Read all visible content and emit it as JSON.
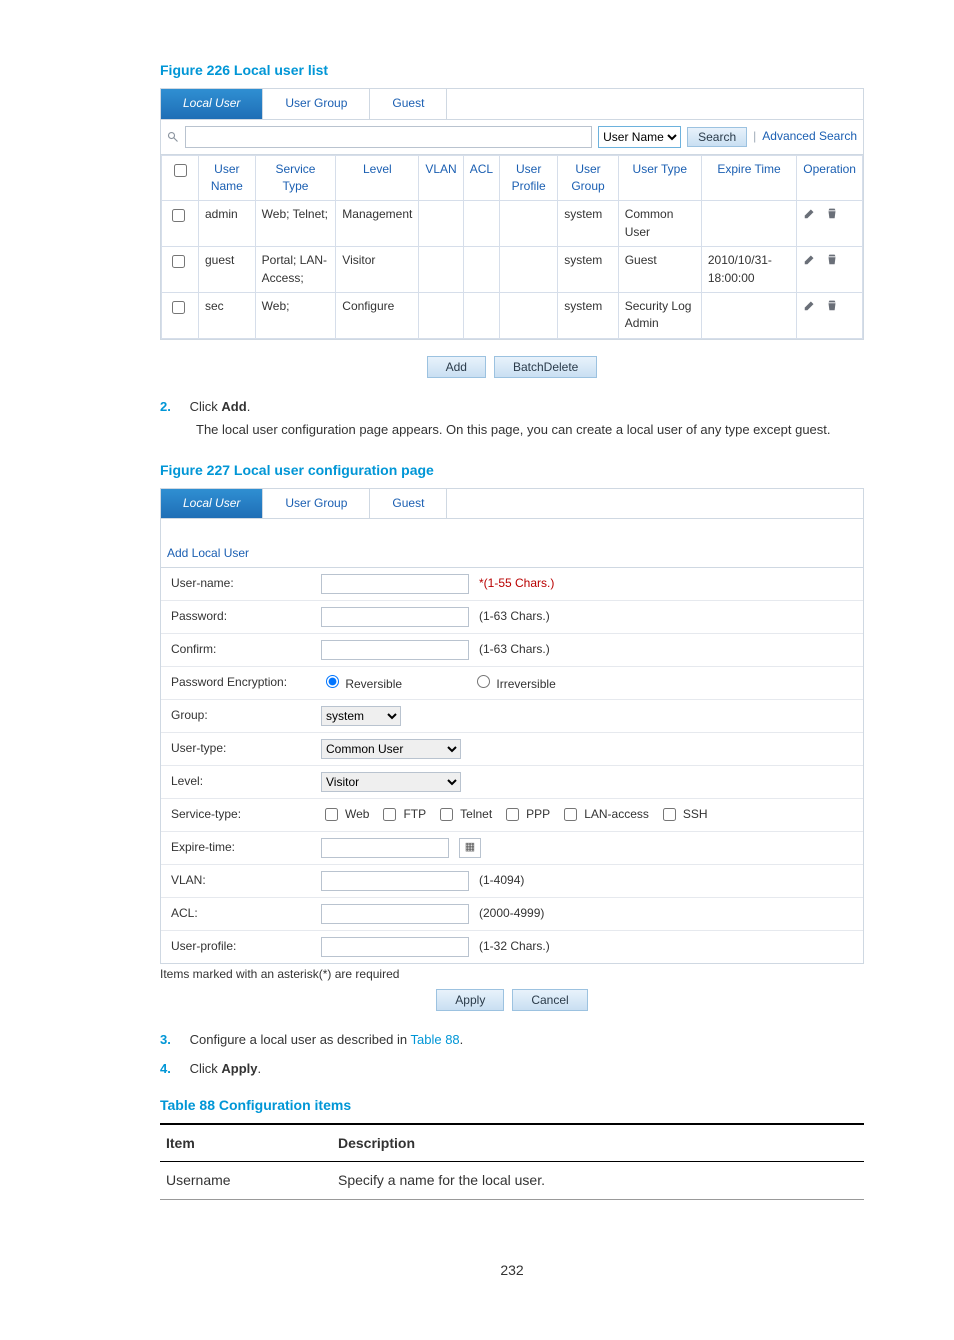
{
  "figure226_caption": "Figure 226 Local user list",
  "figure227_caption": "Figure 227 Local user configuration page",
  "tabs": [
    "Local User",
    "User Group",
    "Guest"
  ],
  "search": {
    "dropdown": "User Name",
    "button": "Search",
    "advanced": "Advanced Search"
  },
  "table_headers": [
    "",
    "User Name",
    "Service Type",
    "Level",
    "VLAN",
    "ACL",
    "User Profile",
    "User Group",
    "User Type",
    "Expire Time",
    "Operation"
  ],
  "rows": [
    {
      "username": "admin",
      "service": "Web; Telnet;",
      "level": "Management",
      "vlan": "",
      "acl": "",
      "profile": "",
      "group": "system",
      "utype": "Common User",
      "expire": ""
    },
    {
      "username": "guest",
      "service": "Portal; LAN-Access;",
      "level": "Visitor",
      "vlan": "",
      "acl": "",
      "profile": "",
      "group": "system",
      "utype": "Guest",
      "expire": "2010/10/31-18:00:00"
    },
    {
      "username": "sec",
      "service": "Web;",
      "level": "Configure",
      "vlan": "",
      "acl": "",
      "profile": "",
      "group": "system",
      "utype": "Security Log Admin",
      "expire": ""
    }
  ],
  "buttons": {
    "add": "Add",
    "batchdelete": "BatchDelete",
    "apply": "Apply",
    "cancel": "Cancel"
  },
  "step2_num": "2.",
  "step2_text_a": "Click ",
  "step2_text_b": "Add",
  "step2_text_c": ".",
  "step2_desc": "The local user configuration page appears. On this page, you can create a local user of any type except guest.",
  "add_local_user": "Add Local User",
  "form": {
    "username_lbl": "User-name:",
    "username_hint": "*(1-55 Chars.)",
    "password_lbl": "Password:",
    "password_hint": "(1-63 Chars.)",
    "confirm_lbl": "Confirm:",
    "confirm_hint": "(1-63 Chars.)",
    "enc_lbl": "Password Encryption:",
    "enc_rev": "Reversible",
    "enc_irr": "Irreversible",
    "group_lbl": "Group:",
    "group_val": "system",
    "usertype_lbl": "User-type:",
    "usertype_val": "Common User",
    "level_lbl": "Level:",
    "level_val": "Visitor",
    "service_lbl": "Service-type:",
    "svc_web": "Web",
    "svc_ftp": "FTP",
    "svc_telnet": "Telnet",
    "svc_ppp": "PPP",
    "svc_lan": "LAN-access",
    "svc_ssh": "SSH",
    "expire_lbl": "Expire-time:",
    "vlan_lbl": "VLAN:",
    "vlan_hint": "(1-4094)",
    "acl_lbl": "ACL:",
    "acl_hint": "(2000-4999)",
    "profile_lbl": "User-profile:",
    "profile_hint": "(1-32 Chars.)"
  },
  "required_note": "Items marked with an asterisk(*) are required",
  "step3_num": "3.",
  "step3_a": "Configure a local user as described in ",
  "step3_link": "Table 88",
  "step3_b": ".",
  "step4_num": "4.",
  "step4_a": "Click ",
  "step4_b": "Apply",
  "step4_c": ".",
  "table88_caption": "Table 88 Configuration items",
  "desc_header_item": "Item",
  "desc_header_desc": "Description",
  "desc_row_item": "Username",
  "desc_row_desc": "Specify a name for the local user.",
  "page_number": "232"
}
